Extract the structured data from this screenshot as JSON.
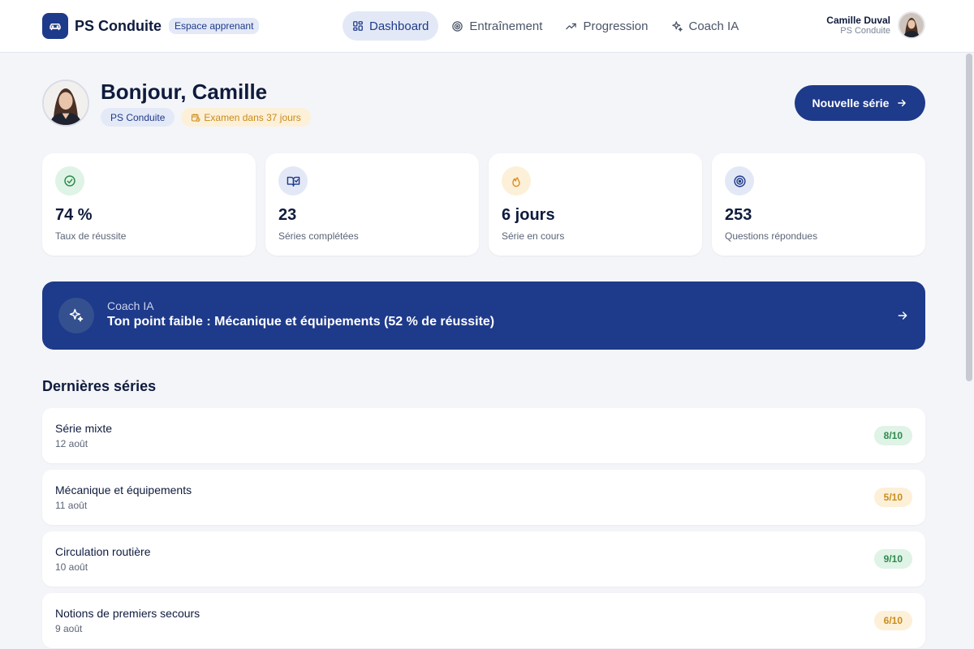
{
  "header": {
    "brand_name": "PS Conduite",
    "brand_badge": "Espace apprenant",
    "nav": [
      {
        "label": "Dashboard",
        "icon": "grid-icon",
        "active": true
      },
      {
        "label": "Entraînement",
        "icon": "target-icon",
        "active": false
      },
      {
        "label": "Progression",
        "icon": "trending-up-icon",
        "active": false
      },
      {
        "label": "Coach IA",
        "icon": "sparkles-icon",
        "active": false
      }
    ],
    "user": {
      "name": "Camille Duval",
      "org": "PS Conduite"
    }
  },
  "greeting": {
    "title": "Bonjour, Camille",
    "school_chip": "PS Conduite",
    "exam_chip": "Examen dans 37 jours",
    "cta_label": "Nouvelle série"
  },
  "stats": [
    {
      "value": "74 %",
      "label": "Taux de réussite",
      "icon": "check-circle-icon"
    },
    {
      "value": "23",
      "label": "Séries complétées",
      "icon": "book-check-icon"
    },
    {
      "value": "6 jours",
      "label": "Série en cours",
      "icon": "flame-icon"
    },
    {
      "value": "253",
      "label": "Questions répondues",
      "icon": "target-icon"
    }
  ],
  "coach": {
    "kicker": "Coach IA",
    "message": "Ton point faible : Mécanique et équipements (52 % de réussite)"
  },
  "recent": {
    "title": "Dernières séries",
    "items": [
      {
        "title": "Série mixte",
        "date": "12 août",
        "score": "8/10",
        "level": "good"
      },
      {
        "title": "Mécanique et équipements",
        "date": "11 août",
        "score": "5/10",
        "level": "mid"
      },
      {
        "title": "Circulation routière",
        "date": "10 août",
        "score": "9/10",
        "level": "good"
      },
      {
        "title": "Notions de premiers secours",
        "date": "9 août",
        "score": "6/10",
        "level": "mid"
      }
    ]
  },
  "colors": {
    "primary": "#1e3a8a",
    "success": "#2f8a4d",
    "warning": "#c98b1b",
    "background": "#f4f5f8"
  }
}
